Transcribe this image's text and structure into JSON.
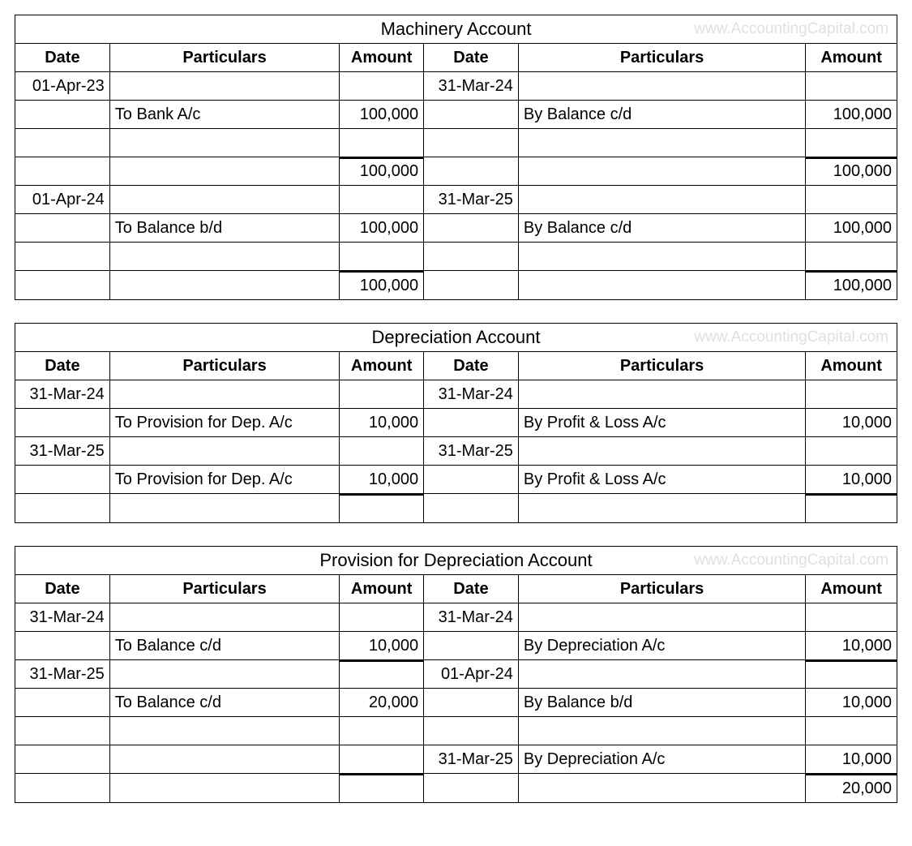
{
  "watermark": "www.AccountingCapital.com",
  "columns": {
    "date": "Date",
    "particulars": "Particulars",
    "amount": "Amount"
  },
  "ledgers": [
    {
      "title": "Machinery Account",
      "rows": [
        {
          "d1": "01-Apr-23",
          "p1": "",
          "a1": "",
          "d2": "31-Mar-24",
          "p2": "",
          "a2": ""
        },
        {
          "d1": "",
          "p1": "To Bank A/c",
          "a1": "100,000",
          "d2": "",
          "p2": "By Balance c/d",
          "a2": "100,000"
        },
        {
          "d1": "",
          "p1": "",
          "a1": "",
          "d2": "",
          "p2": "",
          "a2": ""
        },
        {
          "d1": "",
          "p1": "",
          "a1": "100,000",
          "d2": "",
          "p2": "",
          "a2": "100,000",
          "total": true
        },
        {
          "d1": "01-Apr-24",
          "p1": "",
          "a1": "",
          "d2": "31-Mar-25",
          "p2": "",
          "a2": ""
        },
        {
          "d1": "",
          "p1": "To Balance b/d",
          "a1": "100,000",
          "d2": "",
          "p2": "By Balance c/d",
          "a2": "100,000"
        },
        {
          "d1": "",
          "p1": "",
          "a1": "",
          "d2": "",
          "p2": "",
          "a2": ""
        },
        {
          "d1": "",
          "p1": "",
          "a1": "100,000",
          "d2": "",
          "p2": "",
          "a2": "100,000",
          "total": true,
          "last": true
        }
      ]
    },
    {
      "title": "Depreciation Account",
      "rows": [
        {
          "d1": "31-Mar-24",
          "p1": "",
          "a1": "",
          "d2": "31-Mar-24",
          "p2": "",
          "a2": ""
        },
        {
          "d1": "",
          "p1": "To Provision for Dep. A/c",
          "a1": "10,000",
          "d2": "",
          "p2": "By Profit & Loss A/c",
          "a2": "10,000"
        },
        {
          "d1": "31-Mar-25",
          "p1": "",
          "a1": "",
          "d2": "31-Mar-25",
          "p2": "",
          "a2": ""
        },
        {
          "d1": "",
          "p1": "To Provision for Dep. A/c",
          "a1": "10,000",
          "d2": "",
          "p2": "By Profit & Loss A/c",
          "a2": "10,000"
        },
        {
          "d1": "",
          "p1": "",
          "a1": "",
          "d2": "",
          "p2": "",
          "a2": "",
          "total": true,
          "last": true
        }
      ]
    },
    {
      "title": "Provision for Depreciation Account",
      "rows": [
        {
          "d1": "31-Mar-24",
          "p1": "",
          "a1": "",
          "d2": "31-Mar-24",
          "p2": "",
          "a2": ""
        },
        {
          "d1": "",
          "p1": "To Balance c/d",
          "a1": "10,000",
          "d2": "",
          "p2": "By Depreciation A/c",
          "a2": "10,000"
        },
        {
          "d1": "31-Mar-25",
          "p1": "",
          "a1": "",
          "d2": "01-Apr-24",
          "p2": "",
          "a2": "",
          "total": true
        },
        {
          "d1": "",
          "p1": "To Balance c/d",
          "a1": "20,000",
          "d2": "",
          "p2": "By Balance b/d",
          "a2": "10,000"
        },
        {
          "d1": "",
          "p1": "",
          "a1": "",
          "d2": "",
          "p2": "",
          "a2": ""
        },
        {
          "d1": "",
          "p1": "",
          "a1": "",
          "d2": "31-Mar-25",
          "p2": "By Depreciation A/c",
          "a2": "10,000"
        },
        {
          "d1": "",
          "p1": "",
          "a1": "",
          "d2": "",
          "p2": "",
          "a2": "20,000",
          "total": true,
          "last": true
        }
      ]
    }
  ]
}
